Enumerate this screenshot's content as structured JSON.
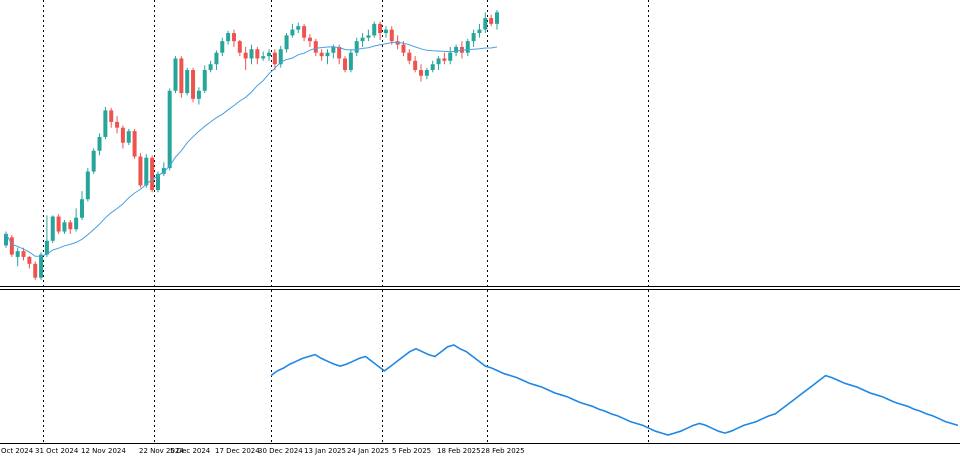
{
  "colors": {
    "bull": "#26a69a",
    "bear": "#ef5350",
    "ma_line": "#4a9fe0",
    "indicator_line": "#1e88e5",
    "grid": "#000000",
    "separator": "#000000",
    "background": "#ffffff"
  },
  "chart_data": [
    {
      "type": "candlestick",
      "title": "",
      "x_labels": [
        "Oct 2024",
        "31 Oct 2024",
        "12 Nov 2024",
        "22 Nov 2024",
        "5 Dec 2024",
        "17 Dec 2024",
        "30 Dec 2024",
        "13 Jan 2025",
        "24 Jan 2025",
        "5 Feb 2025",
        "18 Feb 2025",
        "28 Feb 2025"
      ],
      "grid": "vertical dashed",
      "y_axis_labels": "none",
      "candles": [
        [
          0,
          48,
          58,
          46,
          60
        ],
        [
          1,
          55,
          40,
          38,
          57
        ],
        [
          2,
          38,
          43,
          30,
          46
        ],
        [
          3,
          43,
          38,
          35,
          46
        ],
        [
          4,
          38,
          32,
          28,
          39
        ],
        [
          5,
          32,
          20,
          18,
          34
        ],
        [
          6,
          20,
          40,
          18,
          42
        ],
        [
          7,
          40,
          52,
          38,
          74
        ],
        [
          8,
          52,
          73,
          50,
          74
        ],
        [
          9,
          73,
          60,
          58,
          75
        ],
        [
          10,
          60,
          68,
          58,
          70
        ],
        [
          11,
          68,
          62,
          58,
          70
        ],
        [
          12,
          62,
          72,
          60,
          80
        ],
        [
          13,
          72,
          88,
          70,
          95
        ],
        [
          14,
          88,
          112,
          86,
          115
        ],
        [
          15,
          112,
          130,
          110,
          132
        ],
        [
          16,
          130,
          142,
          126,
          145
        ],
        [
          17,
          142,
          165,
          140,
          168
        ],
        [
          18,
          165,
          155,
          150,
          167
        ],
        [
          19,
          155,
          150,
          145,
          160
        ],
        [
          20,
          150,
          137,
          132,
          152
        ],
        [
          21,
          137,
          147,
          135,
          149
        ],
        [
          22,
          147,
          125,
          123,
          149
        ],
        [
          23,
          125,
          100,
          98,
          128
        ],
        [
          24,
          100,
          124,
          98,
          127
        ],
        [
          25,
          124,
          96,
          94,
          126
        ],
        [
          26,
          96,
          110,
          94,
          112
        ],
        [
          27,
          110,
          115,
          108,
          120
        ],
        [
          28,
          115,
          182,
          113,
          184
        ],
        [
          29,
          182,
          210,
          180,
          212
        ],
        [
          30,
          210,
          180,
          176,
          212
        ],
        [
          31,
          180,
          200,
          178,
          202
        ],
        [
          32,
          200,
          175,
          172,
          202
        ],
        [
          33,
          175,
          182,
          170,
          185
        ],
        [
          34,
          182,
          200,
          180,
          204
        ],
        [
          35,
          200,
          205,
          198,
          208
        ],
        [
          36,
          205,
          215,
          200,
          217
        ],
        [
          37,
          215,
          225,
          212,
          228
        ],
        [
          38,
          225,
          232,
          222,
          234
        ],
        [
          39,
          232,
          225,
          220,
          235
        ],
        [
          40,
          225,
          215,
          212,
          226
        ],
        [
          41,
          215,
          210,
          200,
          220
        ],
        [
          42,
          210,
          218,
          205,
          222
        ],
        [
          43,
          218,
          210,
          205,
          220
        ],
        [
          44,
          210,
          212,
          208,
          216
        ],
        [
          45,
          212,
          215,
          208,
          218
        ],
        [
          46,
          215,
          205,
          200,
          218
        ],
        [
          47,
          205,
          218,
          202,
          221
        ],
        [
          48,
          218,
          230,
          215,
          232
        ],
        [
          49,
          230,
          235,
          228,
          240
        ],
        [
          50,
          235,
          238,
          232,
          241
        ],
        [
          51,
          238,
          228,
          225,
          240
        ],
        [
          52,
          228,
          225,
          220,
          231
        ],
        [
          53,
          225,
          215,
          212,
          227
        ],
        [
          54,
          215,
          212,
          208,
          218
        ],
        [
          55,
          212,
          215,
          205,
          218
        ],
        [
          56,
          215,
          220,
          210,
          222
        ],
        [
          57,
          220,
          210,
          205,
          222
        ],
        [
          58,
          210,
          200,
          198,
          212
        ],
        [
          59,
          200,
          215,
          198,
          218
        ],
        [
          60,
          215,
          225,
          212,
          228
        ],
        [
          61,
          225,
          228,
          220,
          232
        ],
        [
          62,
          228,
          230,
          225,
          235
        ],
        [
          63,
          230,
          240,
          228,
          242
        ],
        [
          64,
          240,
          232,
          226,
          242
        ],
        [
          65,
          232,
          235,
          228,
          238
        ],
        [
          66,
          235,
          225,
          222,
          238
        ],
        [
          67,
          225,
          222,
          218,
          230
        ],
        [
          68,
          222,
          215,
          212,
          225
        ],
        [
          69,
          215,
          208,
          205,
          218
        ],
        [
          70,
          208,
          200,
          198,
          212
        ],
        [
          71,
          200,
          195,
          190,
          205
        ],
        [
          72,
          195,
          200,
          192,
          202
        ],
        [
          73,
          200,
          205,
          198,
          208
        ],
        [
          74,
          205,
          210,
          200,
          212
        ],
        [
          75,
          210,
          208,
          205,
          215
        ],
        [
          76,
          208,
          215,
          205,
          220
        ],
        [
          77,
          215,
          220,
          212,
          222
        ],
        [
          78,
          220,
          215,
          210,
          225
        ],
        [
          79,
          215,
          225,
          212,
          227
        ],
        [
          80,
          225,
          232,
          220,
          235
        ],
        [
          81,
          232,
          235,
          228,
          240
        ],
        [
          82,
          235,
          245,
          232,
          250
        ],
        [
          83,
          245,
          240,
          238,
          248
        ],
        [
          84,
          240,
          250,
          235,
          252
        ]
      ],
      "ma_period": 20
    },
    {
      "type": "line",
      "title": "",
      "grid": "vertical dashed",
      "series": [
        {
          "values": [
            40,
            45,
            48,
            52,
            55,
            58,
            60,
            62,
            58,
            55,
            52,
            50,
            52,
            55,
            58,
            60,
            55,
            50,
            45,
            50,
            55,
            60,
            65,
            68,
            65,
            62,
            60,
            65,
            70,
            72,
            68,
            65,
            60,
            55,
            50,
            48,
            45,
            42,
            40,
            38,
            35,
            32,
            30,
            28,
            25,
            22,
            20,
            18,
            15,
            12,
            10,
            8,
            5,
            3,
            0,
            -2,
            -5,
            -8,
            -10,
            -12,
            -15,
            -18,
            -20,
            -22,
            -20,
            -18,
            -15,
            -12,
            -10,
            -12,
            -15,
            -18,
            -20,
            -18,
            -15,
            -12,
            -10,
            -8,
            -5,
            -2,
            0,
            5,
            10,
            15,
            20,
            25,
            30,
            35,
            40,
            38,
            35,
            32,
            30,
            28,
            25,
            22,
            20,
            18,
            15,
            12,
            10,
            8,
            5,
            3,
            0,
            -2,
            -5,
            -8,
            -10,
            -12
          ]
        }
      ]
    }
  ]
}
